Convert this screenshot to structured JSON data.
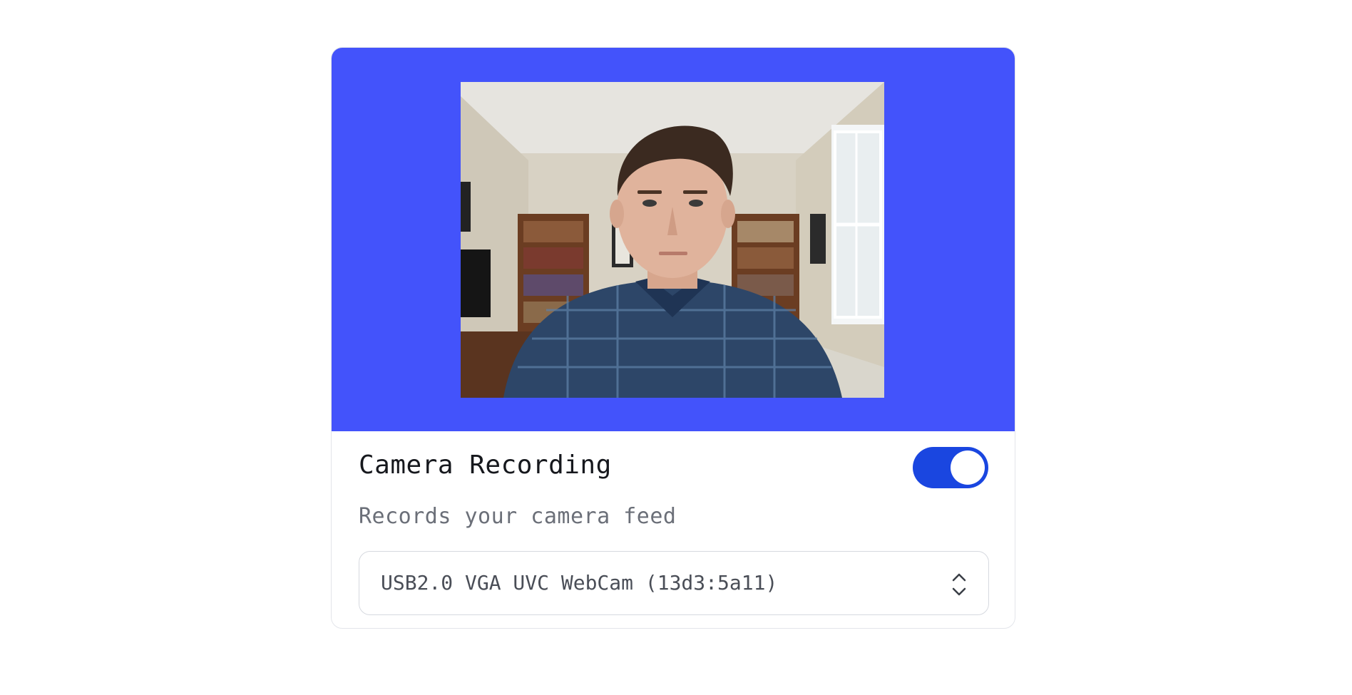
{
  "camera_card": {
    "title": "Camera Recording",
    "description": "Records your camera feed",
    "toggle_on": true,
    "device": {
      "selected": "USB2.0 VGA UVC WebCam (13d3:5a11)"
    },
    "colors": {
      "preview_background": "#4353fb",
      "toggle_on": "#1a46e0"
    },
    "icons": {
      "select": "chevron-up-down-icon"
    }
  }
}
